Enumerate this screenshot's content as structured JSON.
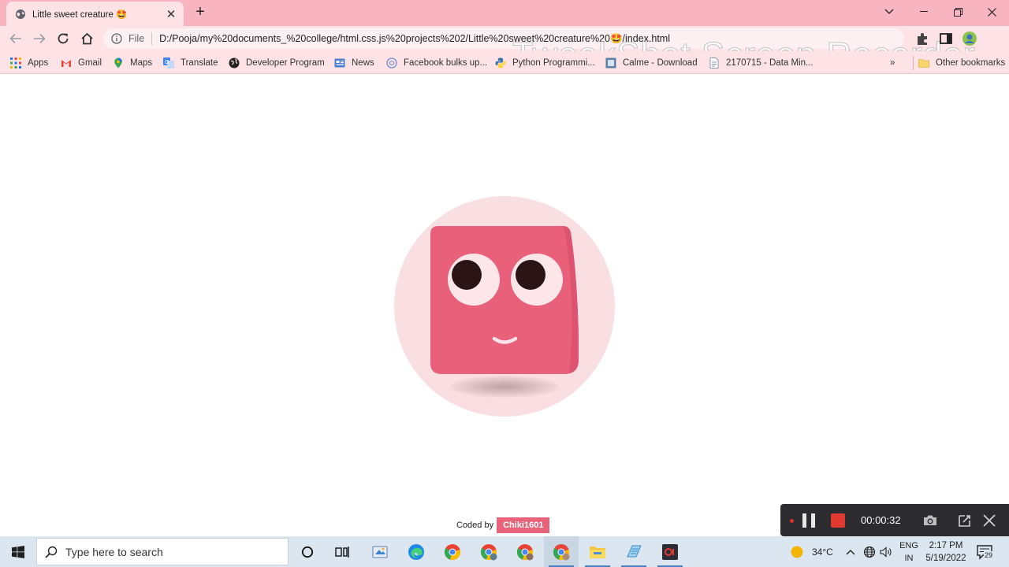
{
  "browser": {
    "tab_title": "Little sweet creature 🤩",
    "new_tab_symbol": "+",
    "scheme_label": "File",
    "url": "D:/Pooja/my%20documents_%20college/html.css.js%20projects%202/Little%20sweet%20creature%20🤩/index.html",
    "watermark": "TweakShot Screen Recorder"
  },
  "bookmarks": {
    "items": [
      {
        "label": "Apps",
        "icon": "apps-grid-icon"
      },
      {
        "label": "Gmail",
        "icon": "gmail-icon"
      },
      {
        "label": "Maps",
        "icon": "maps-pin-icon"
      },
      {
        "label": "Translate",
        "icon": "translate-icon"
      },
      {
        "label": "Developer Program",
        "icon": "developer-globe-icon"
      },
      {
        "label": "News",
        "icon": "news-icon"
      },
      {
        "label": "Facebook bulks up...",
        "icon": "facebook-link-icon"
      },
      {
        "label": "Python Programmi...",
        "icon": "python-icon"
      },
      {
        "label": "Calme - Download",
        "icon": "calme-icon"
      },
      {
        "label": "2170715 - Data Min...",
        "icon": "document-icon"
      }
    ],
    "overflow_symbol": "»",
    "other_bookmarks": "Other bookmarks"
  },
  "page": {
    "footer_label": "Coded by",
    "footer_author": "Chiki1601"
  },
  "recorder": {
    "timer": "00:00:32"
  },
  "taskbar": {
    "search_placeholder": "Type here to search",
    "weather": "34°C",
    "lang_line1": "ENG",
    "lang_line2": "IN",
    "time": "2:17 PM",
    "date": "5/19/2022",
    "notification_count": "29"
  },
  "colors": {
    "chrome_pink": "#f8b4c0",
    "creature_body": "#e8607a",
    "halo": "#f9dfe2",
    "eye_white": "#fde6ea",
    "pupil": "#2a1416",
    "footer_badge": "#e8637a"
  }
}
